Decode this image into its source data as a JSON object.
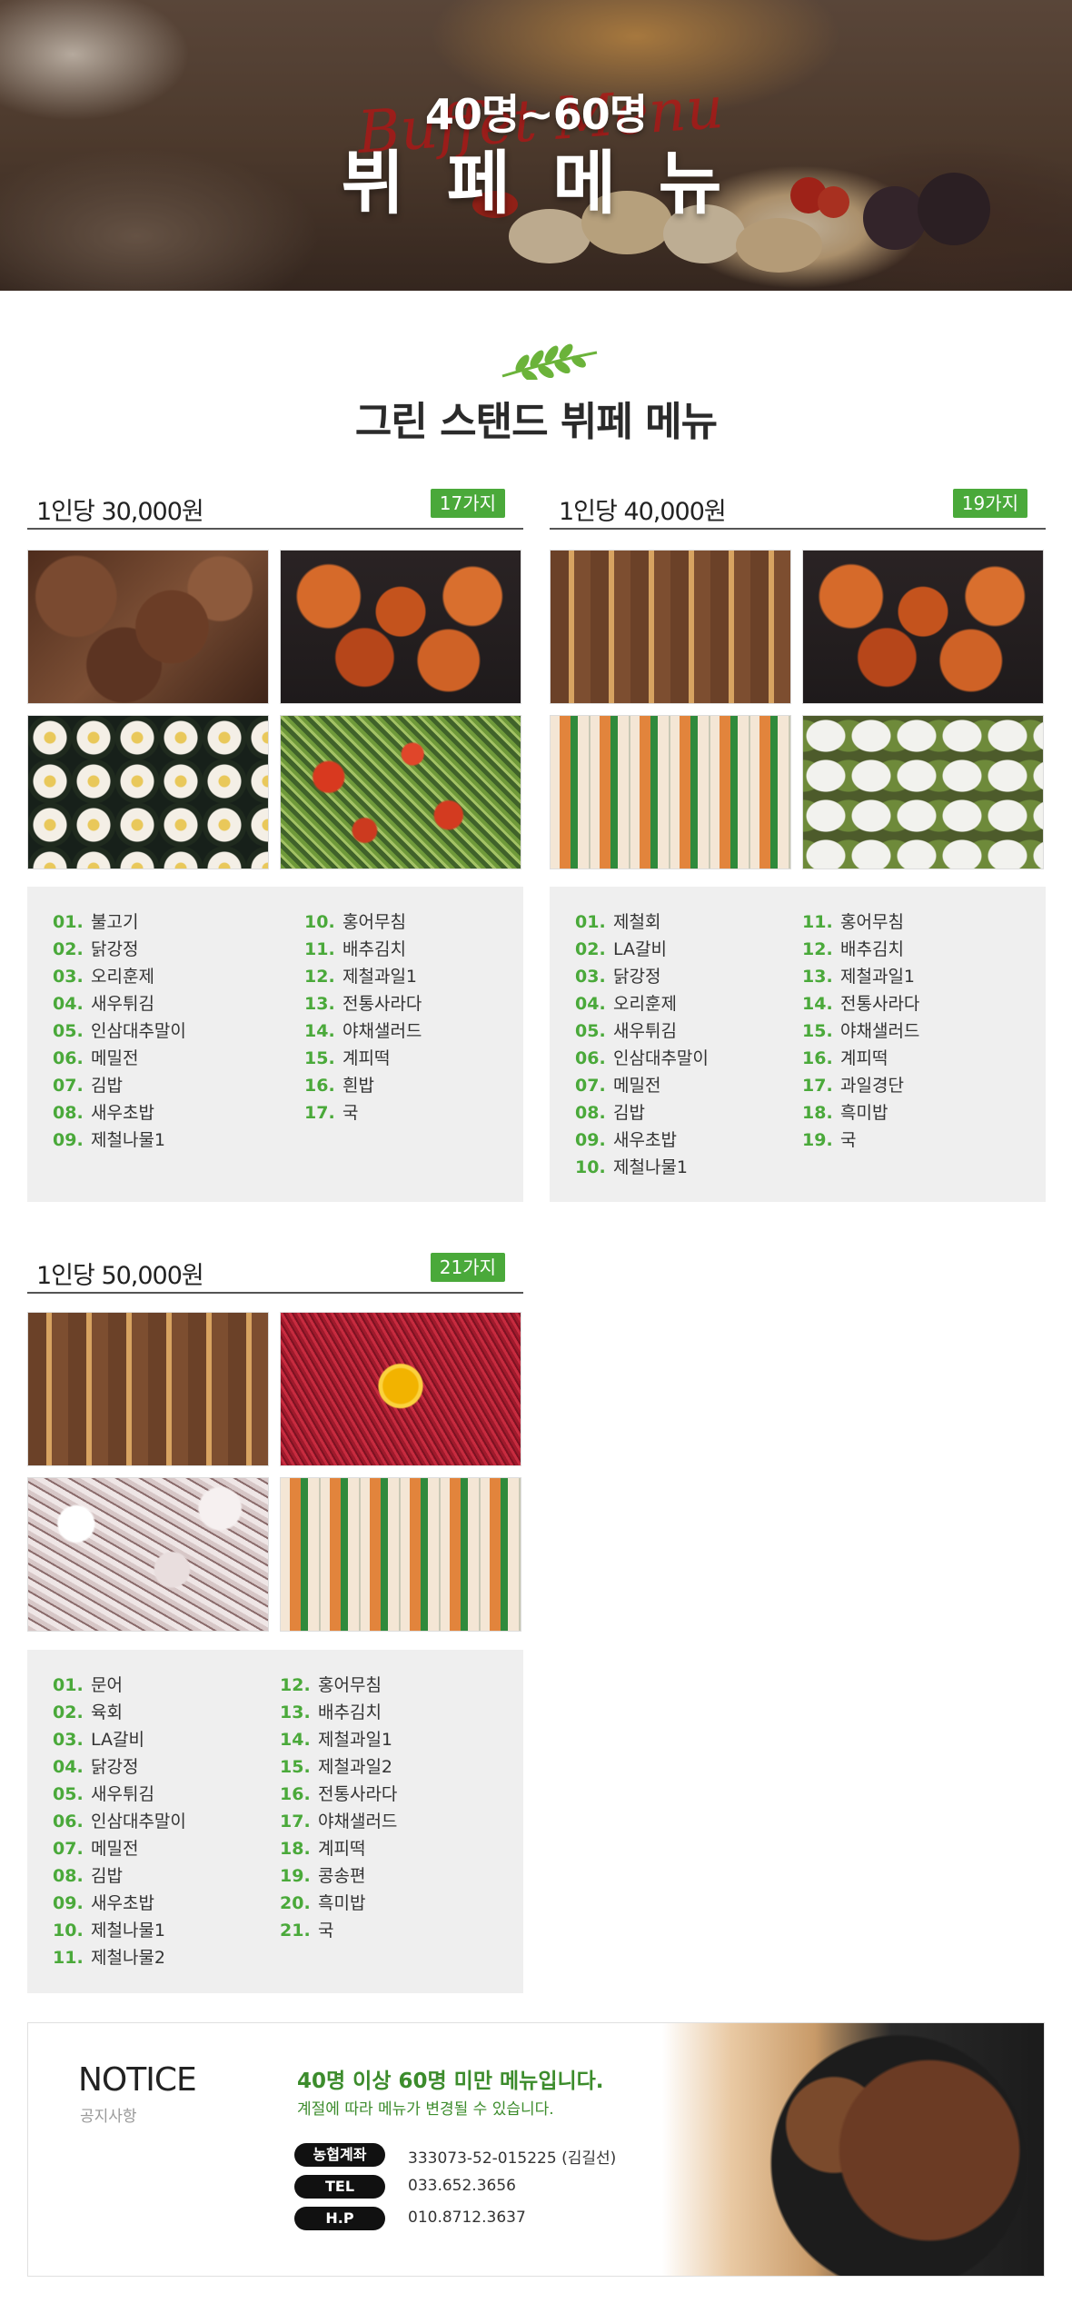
{
  "hero": {
    "subtitle": "40명~60명",
    "title": "뷔 페 메 뉴",
    "script": "Buffet Menu"
  },
  "section_title": "그린 스탠드 뷔페 메뉴",
  "colors": {
    "accent_green": "#4aa93a",
    "notice_green": "#3c8c2c"
  },
  "blocks": {
    "b30": {
      "price": "1인당 30,000원",
      "badge": "17가지",
      "photos": [
        "bulgogi",
        "chicken",
        "gimbap",
        "salad"
      ],
      "col1": [
        {
          "n": "01.",
          "t": "불고기"
        },
        {
          "n": "02.",
          "t": "닭강정"
        },
        {
          "n": "03.",
          "t": "오리훈제"
        },
        {
          "n": "04.",
          "t": "새우튀김"
        },
        {
          "n": "05.",
          "t": "인삼대추말이"
        },
        {
          "n": "06.",
          "t": "메밀전"
        },
        {
          "n": "07.",
          "t": "김밥"
        },
        {
          "n": "08.",
          "t": "새우초밥"
        },
        {
          "n": "09.",
          "t": "제철나물1"
        }
      ],
      "col2": [
        {
          "n": "10.",
          "t": "홍어무침"
        },
        {
          "n": "11.",
          "t": "배추김치"
        },
        {
          "n": "12.",
          "t": "제철과일1"
        },
        {
          "n": "13.",
          "t": "전통사라다"
        },
        {
          "n": "14.",
          "t": "야채샐러드"
        },
        {
          "n": "15.",
          "t": "계피떡"
        },
        {
          "n": "16.",
          "t": "흰밥"
        },
        {
          "n": "17.",
          "t": "국"
        }
      ]
    },
    "b40": {
      "price": "1인당 40,000원",
      "badge": "19가지",
      "photos": [
        "galbi",
        "chicken",
        "rolls",
        "ricecake"
      ],
      "col1": [
        {
          "n": "01.",
          "t": "제철회"
        },
        {
          "n": "02.",
          "t": "LA갈비"
        },
        {
          "n": "03.",
          "t": "닭강정"
        },
        {
          "n": "04.",
          "t": "오리훈제"
        },
        {
          "n": "05.",
          "t": "새우튀김"
        },
        {
          "n": "06.",
          "t": "인삼대추말이"
        },
        {
          "n": "07.",
          "t": "메밀전"
        },
        {
          "n": "08.",
          "t": "김밥"
        },
        {
          "n": "09.",
          "t": "새우초밥"
        },
        {
          "n": "10.",
          "t": "제철나물1"
        }
      ],
      "col2": [
        {
          "n": "11.",
          "t": "홍어무침"
        },
        {
          "n": "12.",
          "t": "배추김치"
        },
        {
          "n": "13.",
          "t": "제철과일1"
        },
        {
          "n": "14.",
          "t": "전통사라다"
        },
        {
          "n": "15.",
          "t": "야채샐러드"
        },
        {
          "n": "16.",
          "t": "계피떡"
        },
        {
          "n": "17.",
          "t": "과일경단"
        },
        {
          "n": "18.",
          "t": "흑미밥"
        },
        {
          "n": "19.",
          "t": "국"
        }
      ]
    },
    "b50": {
      "price": "1인당 50,000원",
      "badge": "21가지",
      "photos": [
        "galbi",
        "yukhoe",
        "octopus",
        "rolls"
      ],
      "col1": [
        {
          "n": "01.",
          "t": "문어"
        },
        {
          "n": "02.",
          "t": "육회"
        },
        {
          "n": "03.",
          "t": "LA갈비"
        },
        {
          "n": "04.",
          "t": "닭강정"
        },
        {
          "n": "05.",
          "t": "새우튀김"
        },
        {
          "n": "06.",
          "t": "인삼대추말이"
        },
        {
          "n": "07.",
          "t": "메밀전"
        },
        {
          "n": "08.",
          "t": "김밥"
        },
        {
          "n": "09.",
          "t": "새우초밥"
        },
        {
          "n": "10.",
          "t": "제철나물1"
        },
        {
          "n": "11.",
          "t": "제철나물2"
        }
      ],
      "col2": [
        {
          "n": "12.",
          "t": "홍어무침"
        },
        {
          "n": "13.",
          "t": "배추김치"
        },
        {
          "n": "14.",
          "t": "제철과일1"
        },
        {
          "n": "15.",
          "t": "제철과일2"
        },
        {
          "n": "16.",
          "t": "전통사라다"
        },
        {
          "n": "17.",
          "t": "야채샐러드"
        },
        {
          "n": "18.",
          "t": "계피떡"
        },
        {
          "n": "19.",
          "t": "콩송편"
        },
        {
          "n": "20.",
          "t": "흑미밥"
        },
        {
          "n": "21.",
          "t": "국"
        }
      ]
    }
  },
  "notice": {
    "title": "NOTICE",
    "subtitle": "공지사항",
    "headline": "40명 이상 60명 미만 메뉴입니다.",
    "description": "계절에 따라 메뉴가 변경될 수 있습니다.",
    "rows": [
      {
        "label": "농협계좌",
        "value": "333073-52-015225 (김길선)"
      },
      {
        "label": "TEL",
        "value": "033.652.3656"
      },
      {
        "label": "H.P",
        "value": "010.8712.3637"
      }
    ]
  }
}
